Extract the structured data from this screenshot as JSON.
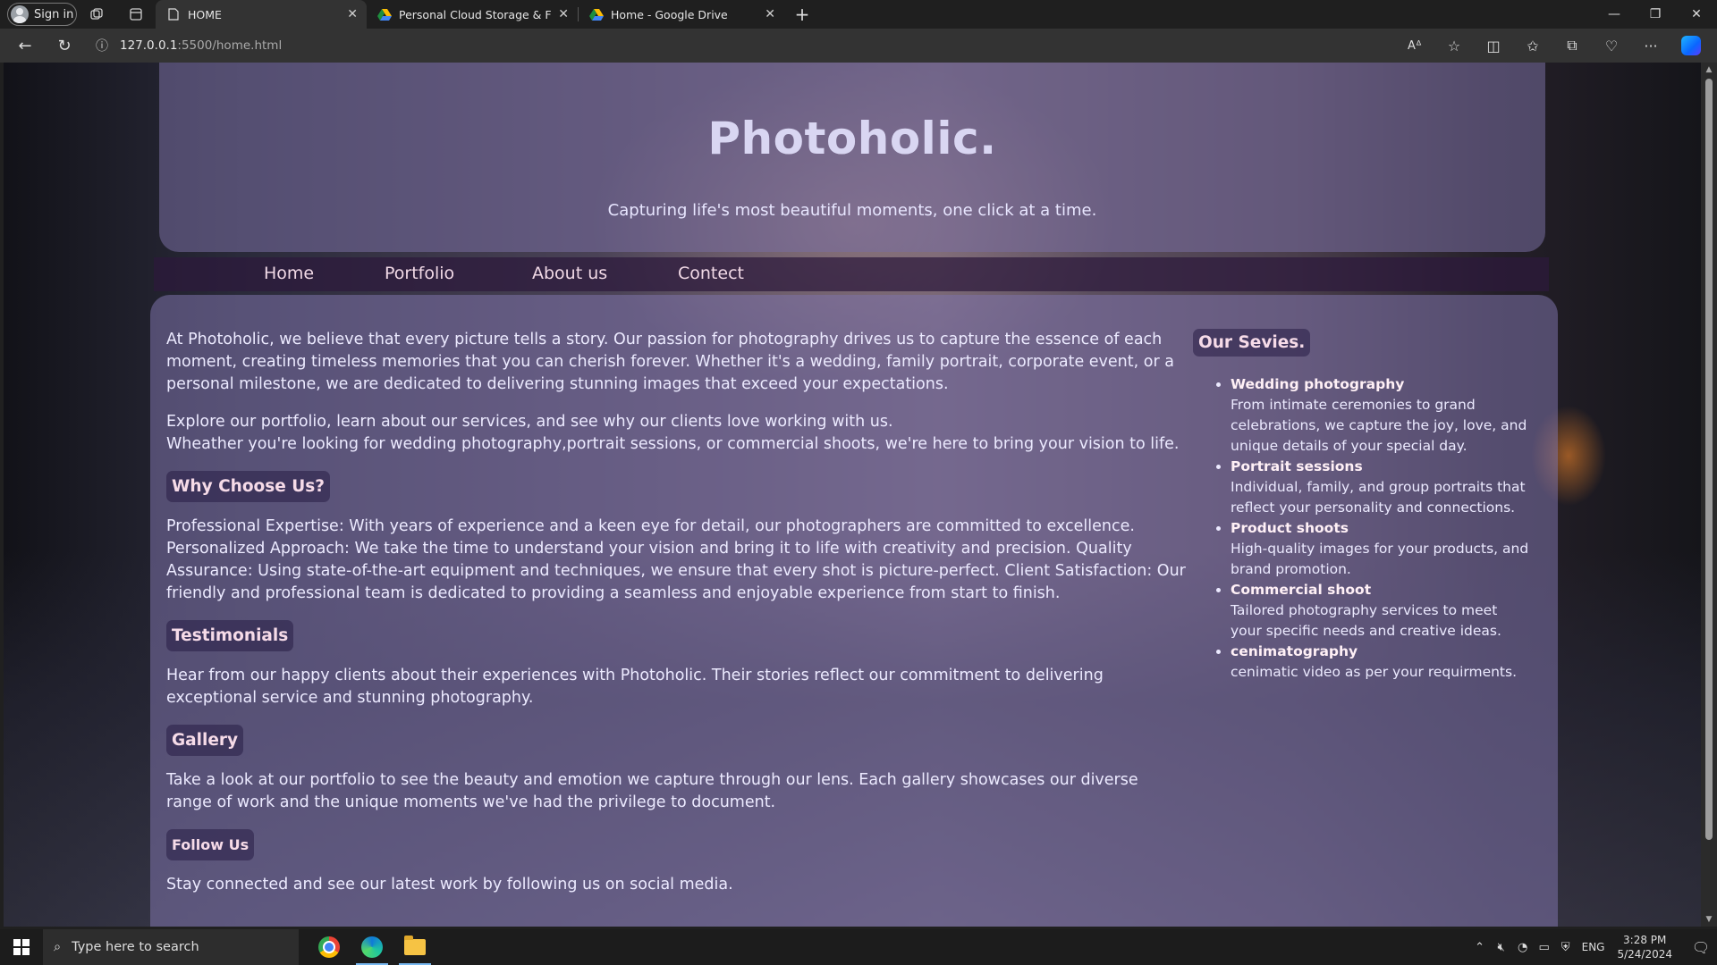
{
  "browser": {
    "profile_label": "Sign in",
    "tabs": [
      {
        "title": "HOME",
        "active": true
      },
      {
        "title": "Personal Cloud Storage & File St",
        "active": false
      },
      {
        "title": "Home - Google Drive",
        "active": false
      }
    ],
    "url_host": "127.0.0.1",
    "url_path": ":5500/home.html"
  },
  "site": {
    "title": "Photoholic.",
    "tagline": "Capturing life's most beautiful moments, one click at a time.",
    "nav": [
      "Home",
      "Portfolio",
      "About us",
      "Contect"
    ],
    "intro_1": "At Photoholic, we believe that every picture tells a story. Our passion for photography drives us to capture the essence of each moment, creating timeless memories that you can cherish forever. Whether it's a wedding, family portrait, corporate event, or a personal milestone, we are dedicated to delivering stunning images that exceed your expectations.",
    "intro_2a": "Explore our portfolio, learn about our services, and see why our clients love working with us.",
    "intro_2b": "Wheather you're looking for wedding photography,portrait sessions, or commercial shoots, we're here to bring your vision to life.",
    "why": {
      "heading": "Why Choose Us?",
      "text": "Professional Expertise: With years of experience and a keen eye for detail, our photographers are committed to excellence. Personalized Approach: We take the time to understand your vision and bring it to life with creativity and precision. Quality Assurance: Using state-of-the-art equipment and techniques, we ensure that every shot is picture-perfect. Client Satisfaction: Our friendly and professional team is dedicated to providing a seamless and enjoyable experience from start to finish."
    },
    "testimonials": {
      "heading": "Testimonials",
      "text": "Hear from our happy clients about their experiences with Photoholic. Their stories reflect our commitment to delivering exceptional service and stunning photography."
    },
    "gallery": {
      "heading": "Gallery",
      "text": "Take a look at our portfolio to see the beauty and emotion we capture through our lens. Each gallery showcases our diverse range of work and the unique moments we've had the privilege to document."
    },
    "follow": {
      "heading": "Follow Us",
      "text": "Stay connected and see our latest work by following us on social media."
    },
    "services": {
      "heading": "Our Sevies.",
      "items": [
        {
          "title": "Wedding photography",
          "desc": "From intimate ceremonies to grand celebrations, we capture the joy, love, and unique details of your special day."
        },
        {
          "title": "Portrait sessions",
          "desc": "Individual, family, and group portraits that reflect your personality and connections."
        },
        {
          "title": "Product shoots",
          "desc": "High-quality images for your products, and brand promotion."
        },
        {
          "title": "Commercial shoot",
          "desc": "Tailored photography services to meet your specific needs and creative ideas."
        },
        {
          "title": "cenimatography",
          "desc": "cenimatic video as per your requirments."
        }
      ]
    }
  },
  "taskbar": {
    "search_placeholder": "Type here to search",
    "language": "ENG",
    "time": "3:28 PM",
    "date": "5/24/2024"
  },
  "icons": [
    "profile-icon",
    "workspaces-icon",
    "tab-actions-icon",
    "page-icon",
    "drive-icon",
    "close-icon",
    "plus-icon",
    "minimize-icon",
    "restore-icon",
    "back-icon",
    "refresh-icon",
    "info-icon",
    "read-aloud-icon",
    "star-icon",
    "split-screen-icon",
    "favorites-icon",
    "collections-icon",
    "extensions-icon",
    "more-icon",
    "copilot-icon",
    "windows-icon",
    "search-icon",
    "chrome-icon",
    "edge-icon",
    "file-explorer-icon",
    "chevron-up-icon",
    "volume-icon",
    "network-icon",
    "notification-icon"
  ],
  "colors": {
    "header_title": "#d9d6f2",
    "section_heading": "#f6dbe8",
    "nav_link": "#f1d9e6"
  }
}
